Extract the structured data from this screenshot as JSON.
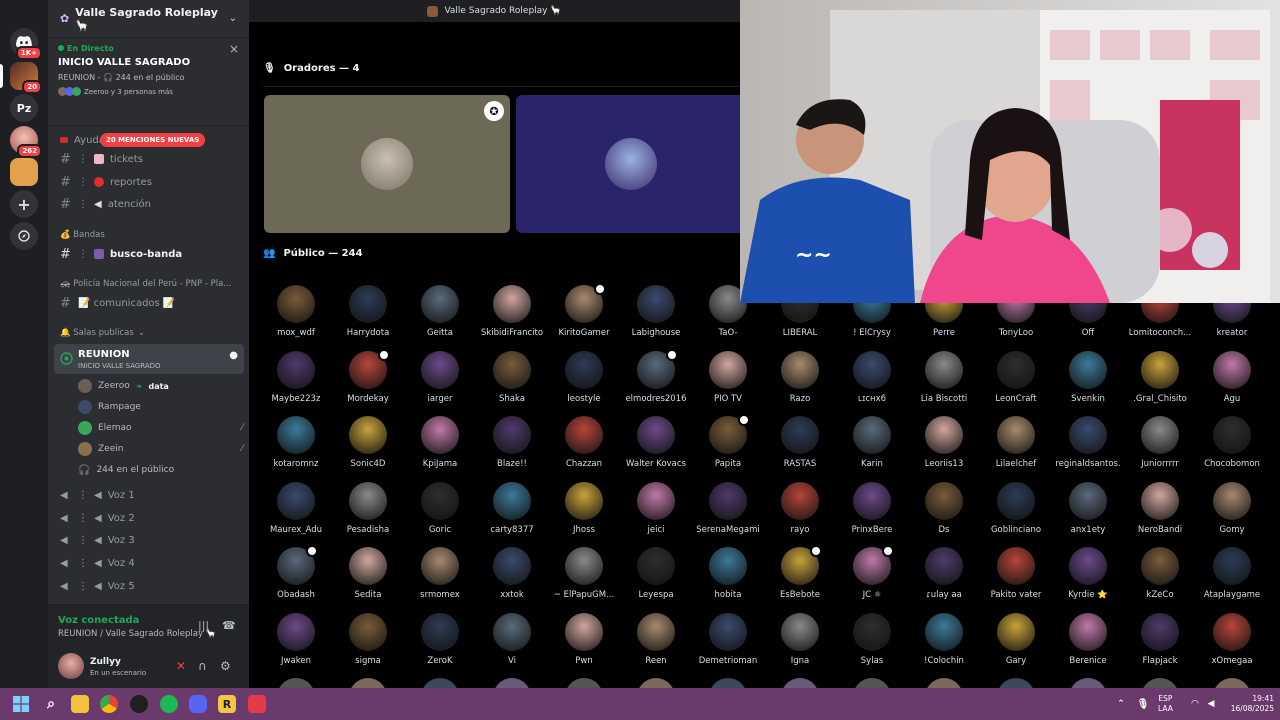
{
  "window_title": "Valle Sagrado Roleplay 🦙",
  "rail": {
    "badge_top": "1K+",
    "badge_2": "20",
    "srv_pz": "Pz",
    "badge_3": "262"
  },
  "server": {
    "name": "Valle Sagrado Roleplay 🦙"
  },
  "event": {
    "live_label": "En Directo",
    "title": "INICIO VALLE SAGRADO",
    "subtitle": "REUNION - 🎧 244 en el público",
    "people": "Zeeroo y 3 personas más"
  },
  "channels": {
    "ayuda": "Ayuda",
    "mentions": "20 MENCIONES NUEVAS",
    "tickets": "tickets",
    "reportes": "reportes",
    "atencion": "atención",
    "cat_bandas": "💰 Bandas",
    "busco_banda": "busco-banda",
    "cat_pnp": "🚓 Policía Nacional del Perú - PNP - Pla...",
    "comunicados": "📝 comunicados 📝",
    "cat_salas": "🔔 Salas publicas",
    "reunion": "REUNION",
    "reunion_sub": "INICIO VALLE SAGRADO",
    "vc_users": [
      {
        "name": "Zeeroo",
        "tag": "data"
      },
      {
        "name": "Rampage",
        "tag": ""
      },
      {
        "name": "Elemao",
        "tag": ""
      },
      {
        "name": "Zeein",
        "tag": ""
      }
    ],
    "audience": "244 en el público",
    "voz": [
      "Voz 1",
      "Voz 2",
      "Voz 3",
      "Voz 4",
      "Voz 5"
    ]
  },
  "voice_connection": {
    "status": "Voz conectada",
    "channel": "REUNION / Valle Sagrado Roleplay 🦙",
    "user": "Zullyy",
    "user_status": "En un escenario"
  },
  "stage": {
    "speakers_label": "Oradores — 4",
    "public_label": "Público — 244"
  },
  "audience_rows": [
    [
      "mox_wdf",
      "Harrydota",
      "Geitta",
      "SkibidiFrancito",
      "KiritoGamer",
      "Labighouse",
      "TaO-",
      "LIBERAL",
      "! ElCrysy",
      "Perre",
      "TonyLoo",
      "Off",
      "Lomitoconch...",
      "kreator"
    ],
    [
      "Maybe223z",
      "Mordekay",
      "iarger",
      "Shaka",
      "leostyle",
      "elmodres2016",
      "PIO TV",
      "Razo",
      "ʟɪᴄʜx6",
      "Lia Biscotti",
      "LeonCraft",
      "Svenkin",
      ".Gral_Chisito",
      "Agu"
    ],
    [
      "kotaromnz",
      "Sonic4D",
      "KpiJama",
      "Blaze!!",
      "Chazzan",
      "Walter Kovacs",
      "Papita",
      "RASTAS",
      "Karin",
      "Leoriis13",
      "Lilaelchef",
      "reginaldsantos.",
      "Juniorrrrr",
      "Chocobomon"
    ],
    [
      "Maurex_Adu",
      "Pesadisha",
      "Goric",
      "carty8377",
      "Jhoss",
      "jeici",
      "SerenaMegami",
      "rayo",
      "PrinxBere",
      "Ds",
      "Goblinciano",
      "anx1ety",
      "NeroBandi",
      "Gomy"
    ],
    [
      "Obadash",
      "Sedita",
      "srmomex",
      "xxtok",
      "~ ElPapuGM...",
      "Leyespa",
      "hobita",
      "EsBebote",
      "JC ⚛",
      "ɾulay aa",
      "Pakito vater",
      "Kyrdie ⭐",
      "kZeCo",
      "Ataplaygame"
    ],
    [
      "Jwaken",
      "sigma",
      "ZeroK",
      "Vi",
      "Pwn",
      "Reen",
      "Demetrioman",
      "Igna",
      "Sylas",
      "!Colochín",
      "Gary",
      "Berenice",
      "Flapjack",
      "xOmegaa"
    ]
  ],
  "taskbar": {
    "lang_1": "ESP",
    "lang_2": "LAA",
    "time": "19:41",
    "date": "16/08/2025"
  },
  "colors": {
    "accent_green": "#23a55a",
    "mention_red": "#f23f43",
    "taskbar": "#6b3a6d"
  }
}
